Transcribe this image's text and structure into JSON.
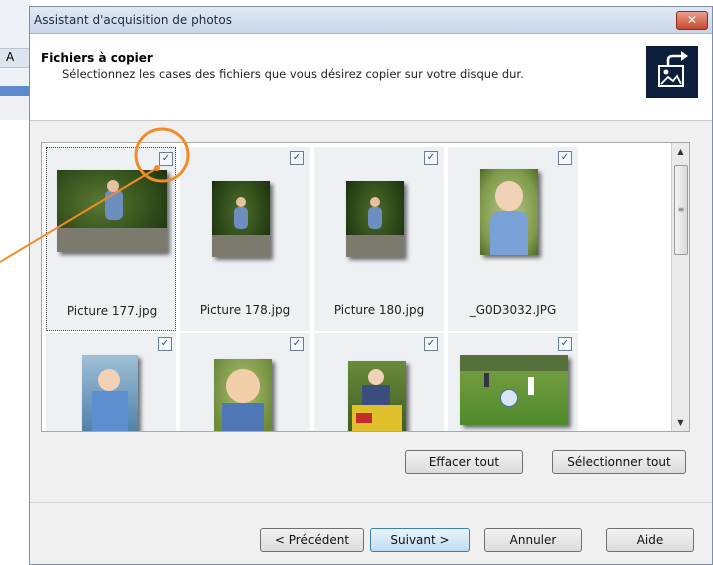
{
  "background_window": {
    "letter": "A"
  },
  "window": {
    "title": "Assistant d'acquisition de photos",
    "close_glyph": "✕"
  },
  "header": {
    "title": "Fichiers à copier",
    "subtitle": "Sélectionnez les cases des fichiers que vous désirez copier sur votre disque dur.",
    "icon": "photo-import-icon"
  },
  "files": [
    {
      "name": "Picture 177.jpg",
      "checked": true
    },
    {
      "name": "Picture 178.jpg",
      "checked": true
    },
    {
      "name": "Picture 180.jpg",
      "checked": true
    },
    {
      "name": "_G0D3032.JPG",
      "checked": true
    },
    {
      "name": "",
      "checked": true
    },
    {
      "name": "",
      "checked": true
    },
    {
      "name": "",
      "checked": true
    },
    {
      "name": "",
      "checked": true
    }
  ],
  "checkbox_glyph": "✓",
  "scrollbar": {
    "up": "▲",
    "down": "▼",
    "grip": "≡"
  },
  "buttons": {
    "clear_all": "Effacer tout",
    "select_all": "Sélectionner tout",
    "previous": "< Précédent",
    "next": "Suivant >",
    "cancel": "Annuler",
    "help": "Aide"
  },
  "colors": {
    "annotation": "#f28c28",
    "header_icon_bg": "#0b1f3d"
  }
}
